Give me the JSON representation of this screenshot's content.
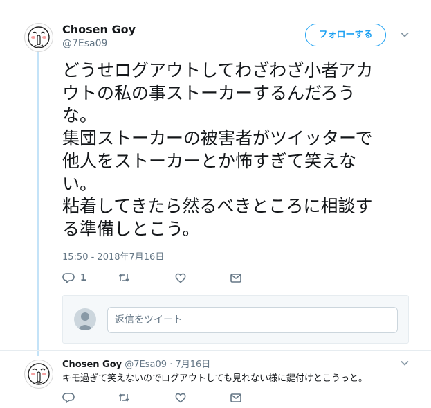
{
  "tweet": {
    "author_name": "Chosen Goy",
    "author_handle": "@7Esa09",
    "follow_label": "フォローする",
    "text_lines": [
      "どうせログアウトしてわざわざ小者アカ",
      "ウトの私の事ストーカーするんだろう",
      "な。",
      "集団ストーカーの被害者がツイッターで",
      "他人をストーカーとか怖すぎて笑えな",
      "い。",
      "粘着してきたら然るべきところに相談す",
      "る準備しとこう。"
    ],
    "timestamp": "15:50 - 2018年7月16日",
    "actions": {
      "reply_count": "1",
      "reply_icon": "reply-icon",
      "retweet_icon": "retweet-icon",
      "like_icon": "heart-icon",
      "dm_icon": "mail-icon"
    }
  },
  "reply_box": {
    "placeholder": "返信をツイート"
  },
  "reply": {
    "author_name": "Chosen Goy",
    "author_handle": "@7Esa09",
    "separator": "·",
    "date": "7月16日",
    "text": "キモ過ぎて笑えないのでログアウトしても見れない様に鍵付けとこうっと。"
  },
  "colors": {
    "accent": "#1da1f2",
    "thread_line": "#c4e3f8",
    "muted": "#657786"
  }
}
